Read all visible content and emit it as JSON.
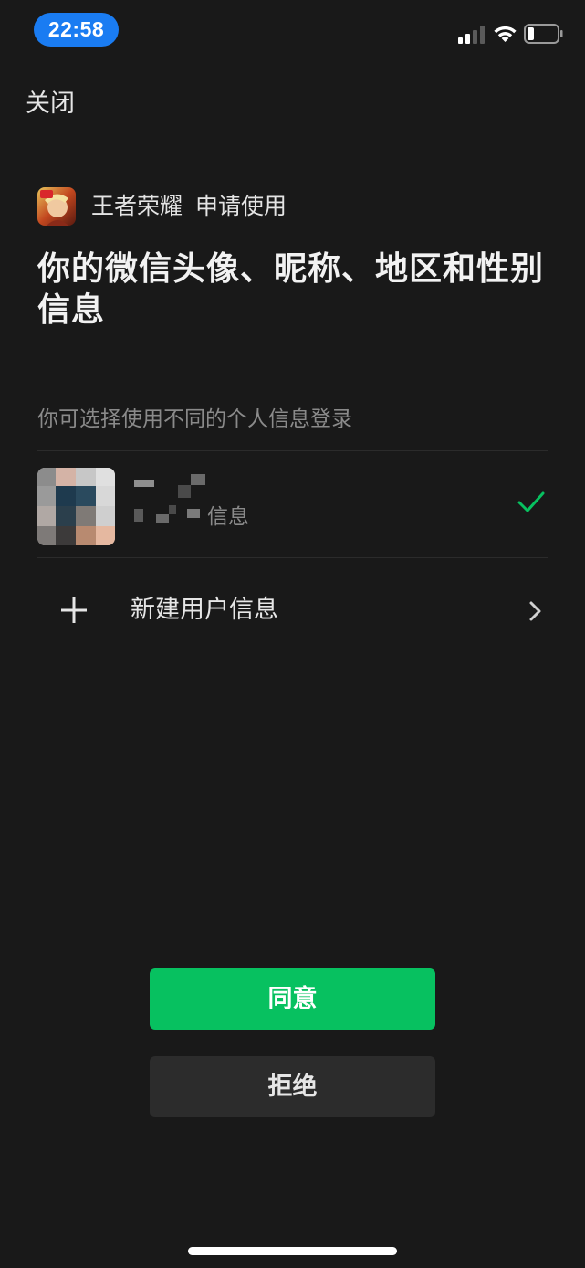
{
  "status_bar": {
    "time": "22:58",
    "time_pill_color": "#1a7cf2",
    "icons": [
      "signal-icon",
      "wifi-icon",
      "battery-icon"
    ],
    "battery_level": 0.2
  },
  "header": {
    "close_label": "关闭"
  },
  "request": {
    "app_name": "王者荣耀",
    "action_text": "申请使用",
    "app_icon": "app-icon",
    "permission_title": "你的微信头像、昵称、地区和性别信息"
  },
  "accounts": {
    "hint": "你可选择使用不同的个人信息登录",
    "current_profile": {
      "name_visible": false,
      "sub_label_visible": "信息",
      "selected": true,
      "check_color": "#07c160"
    },
    "new_user": {
      "label": "新建用户信息",
      "leading_icon": "plus-icon",
      "trailing_icon": "chevron-right-icon"
    }
  },
  "actions": {
    "agree_label": "同意",
    "reject_label": "拒绝",
    "agree_color": "#07c160",
    "reject_color": "#2c2c2c"
  },
  "colors": {
    "background": "#191919",
    "primary_text": "#f2f2f2",
    "secondary_text": "#8a8a8a",
    "accent": "#07c160"
  }
}
